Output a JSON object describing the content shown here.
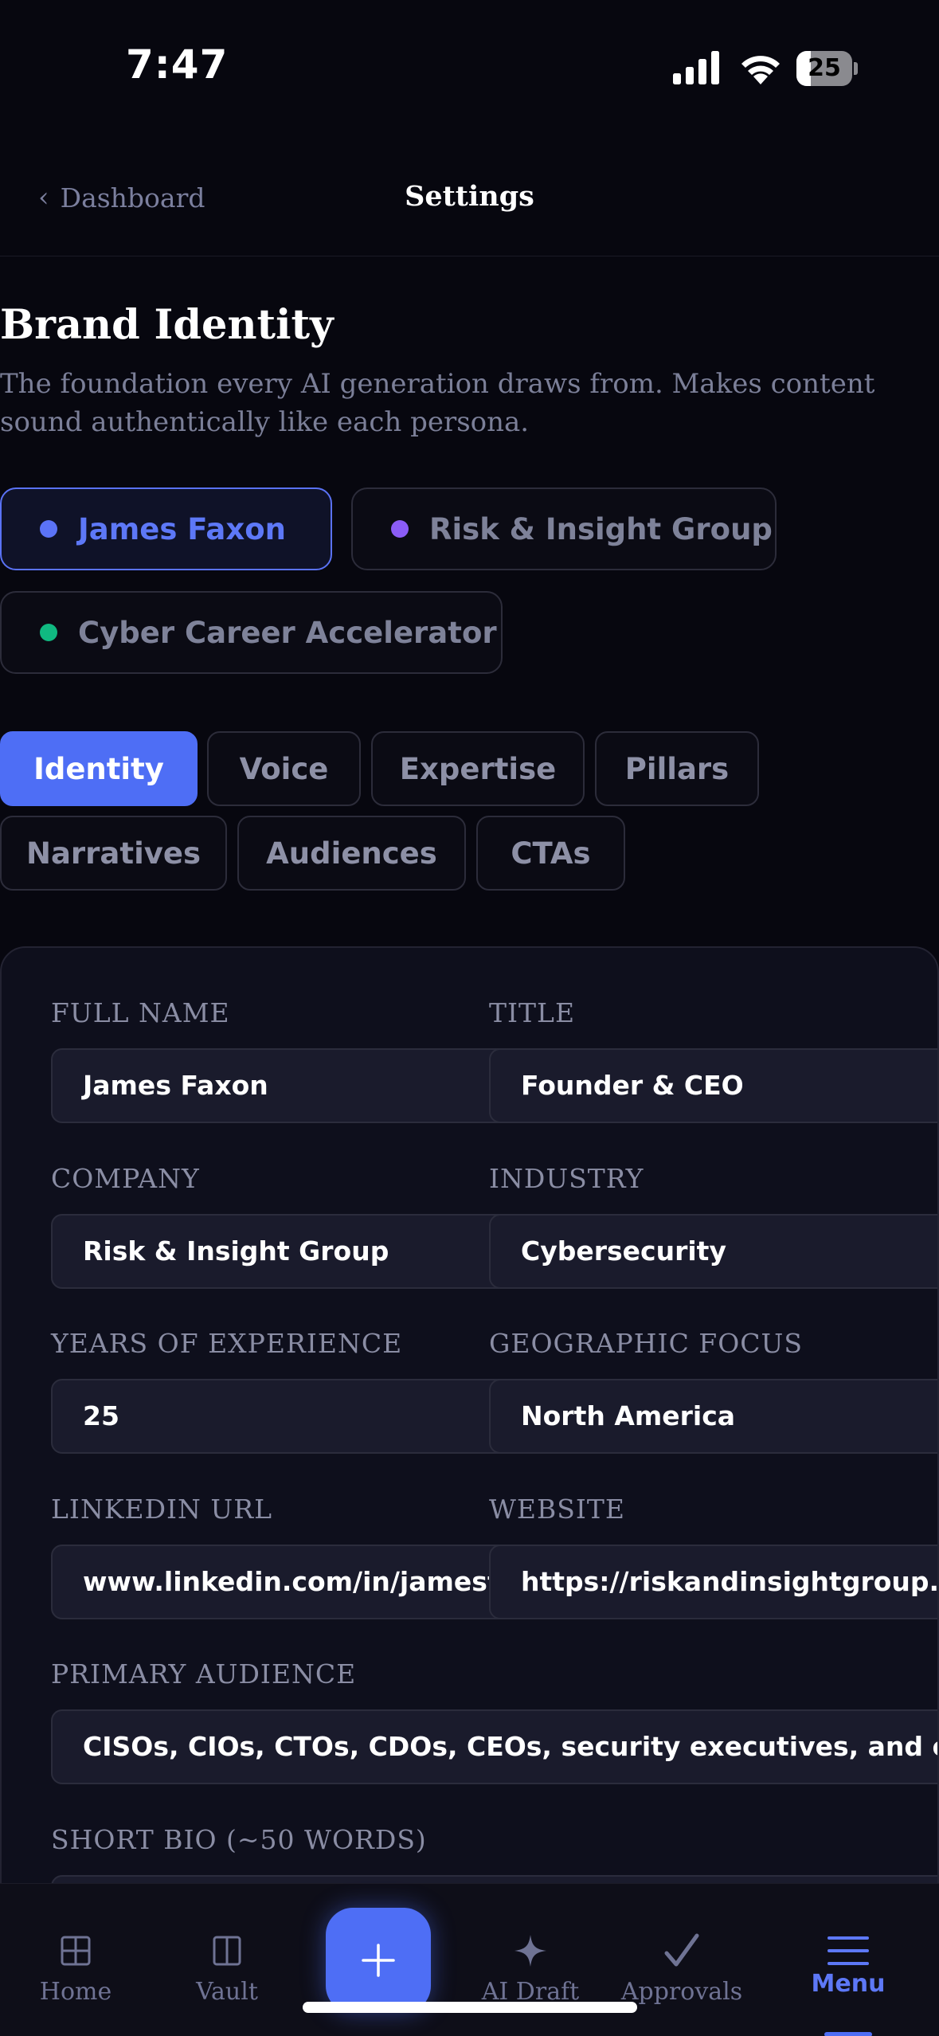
{
  "status_bar": {
    "time": "7:47",
    "battery": "25",
    "battery_level": 0.25
  },
  "nav": {
    "back_label": "Dashboard",
    "title": "Settings"
  },
  "section": {
    "title": "Brand Identity",
    "subtitle": "The foundation every AI generation draws from. Makes content sound authentically like each persona."
  },
  "personas": [
    {
      "label": "James Faxon",
      "color": "#5b73f6",
      "active": true
    },
    {
      "label": "Risk & Insight Group",
      "color": "#8b5cf6",
      "active": false
    },
    {
      "label": "Cyber Career Accelerator",
      "color": "#10b981",
      "active": false
    }
  ],
  "tabs": [
    {
      "label": "Identity",
      "active": true
    },
    {
      "label": "Voice",
      "active": false
    },
    {
      "label": "Expertise",
      "active": false
    },
    {
      "label": "Pillars",
      "active": false
    },
    {
      "label": "Narratives",
      "active": false
    },
    {
      "label": "Audiences",
      "active": false
    },
    {
      "label": "CTAs",
      "active": false
    }
  ],
  "form": {
    "full_name": {
      "label": "FULL NAME",
      "value": "James Faxon"
    },
    "title": {
      "label": "TITLE",
      "value": "Founder & CEO"
    },
    "company": {
      "label": "COMPANY",
      "value": "Risk & Insight Group"
    },
    "industry": {
      "label": "INDUSTRY",
      "value": "Cybersecurity"
    },
    "years": {
      "label": "YEARS OF EXPERIENCE",
      "value": "25"
    },
    "geo": {
      "label": "GEOGRAPHIC FOCUS",
      "value": "North America"
    },
    "linkedin": {
      "label": "LINKEDIN URL",
      "value": "www.linkedin.com/in/jamesfaxon"
    },
    "website": {
      "label": "WEBSITE",
      "value": "https://riskandinsightgroup.com"
    },
    "primary_audience": {
      "label": "PRIMARY AUDIENCE",
      "value": "CISOs, CIOs, CTOs, CDOs, CEOs, security executives, and cybersecurity professionals"
    },
    "short_bio": {
      "label": "SHORT BIO (~50 WORDS)"
    }
  },
  "tabbar": {
    "items": [
      {
        "label": "Home",
        "icon": "grid-icon"
      },
      {
        "label": "Vault",
        "icon": "book-icon"
      },
      {
        "label": "",
        "icon": "plus-icon"
      },
      {
        "label": "AI Draft",
        "icon": "sparkle-icon"
      },
      {
        "label": "Approvals",
        "icon": "check-icon"
      },
      {
        "label": "Menu",
        "icon": "menu-icon",
        "active": true
      }
    ]
  },
  "colors": {
    "accent": "#4e6ef5",
    "background": "#07070f",
    "card": "#0e0f1c"
  }
}
